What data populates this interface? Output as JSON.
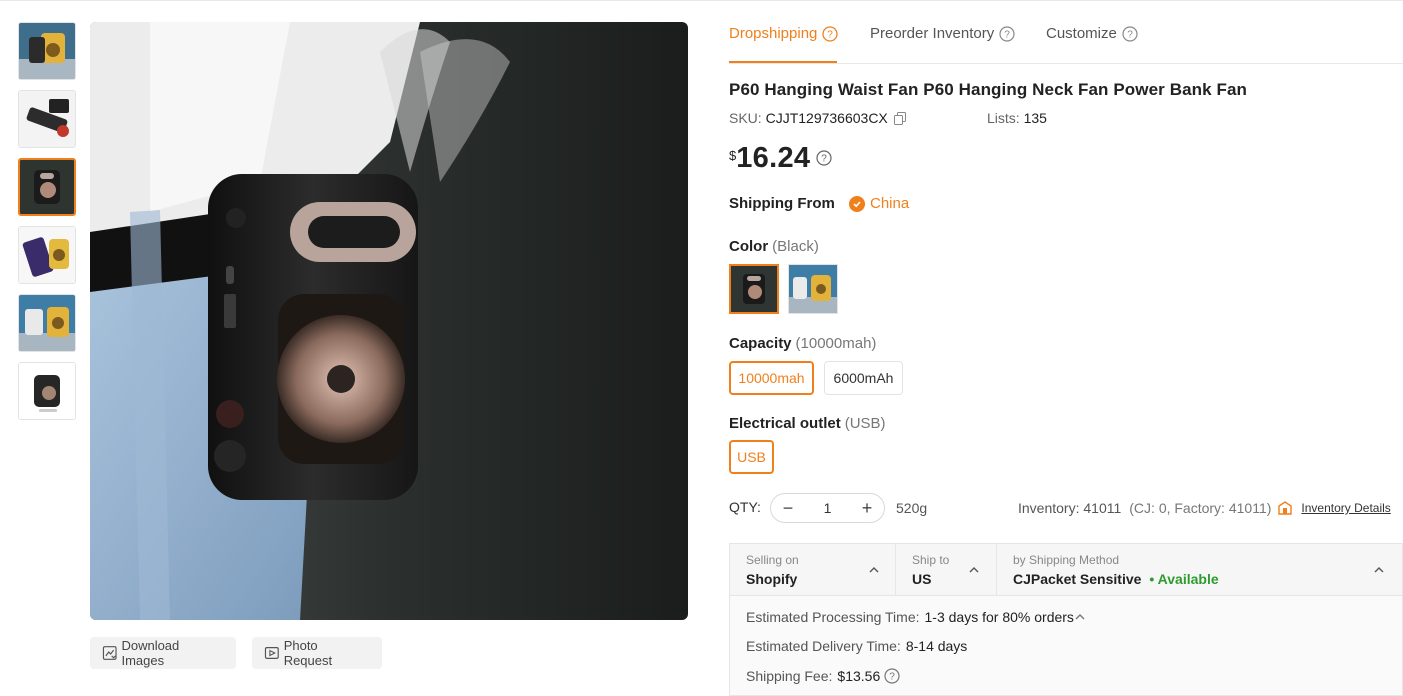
{
  "tabs": [
    {
      "label": "Dropshipping"
    },
    {
      "label": "Preorder Inventory"
    },
    {
      "label": "Customize"
    }
  ],
  "product": {
    "title": "P60 Hanging Waist Fan P60 Hanging Neck Fan Power Bank Fan",
    "sku_label": "SKU:",
    "sku": "CJJT129736603CX",
    "lists_label": "Lists:",
    "lists": "135",
    "currency": "$",
    "price": "16.24"
  },
  "shipping_from": {
    "label": "Shipping From",
    "value": "China"
  },
  "color": {
    "label": "Color",
    "selected": "(Black)"
  },
  "capacity": {
    "label": "Capacity",
    "selected": "(10000mah)",
    "options": [
      "10000mah",
      "6000mAh"
    ]
  },
  "outlet": {
    "label": "Electrical outlet",
    "selected": "(USB)",
    "options": [
      "USB"
    ]
  },
  "qty": {
    "label": "QTY:",
    "value": "1",
    "weight": "520g",
    "inventory": "Inventory: 41011",
    "inventory_detail": "(CJ: 0, Factory: 41011)",
    "inventory_link": "Inventory Details"
  },
  "image_buttons": {
    "download": "Download Images",
    "photo_request": "Photo Request"
  },
  "shipping": {
    "selling_on_label": "Selling on",
    "selling_on": "Shopify",
    "ship_to_label": "Ship to",
    "ship_to": "US",
    "method_label": "by Shipping Method",
    "method": "CJPacket Sensitive",
    "availability": "• Available",
    "processing_label": "Estimated Processing Time:",
    "processing": "1-3 days for 80% orders",
    "delivery_label": "Estimated Delivery Time:",
    "delivery": "8-14 days",
    "fee_label": "Shipping Fee:",
    "fee": "$13.56"
  },
  "colors": {
    "accent": "#f0801c",
    "available": "#2e9b2e"
  }
}
